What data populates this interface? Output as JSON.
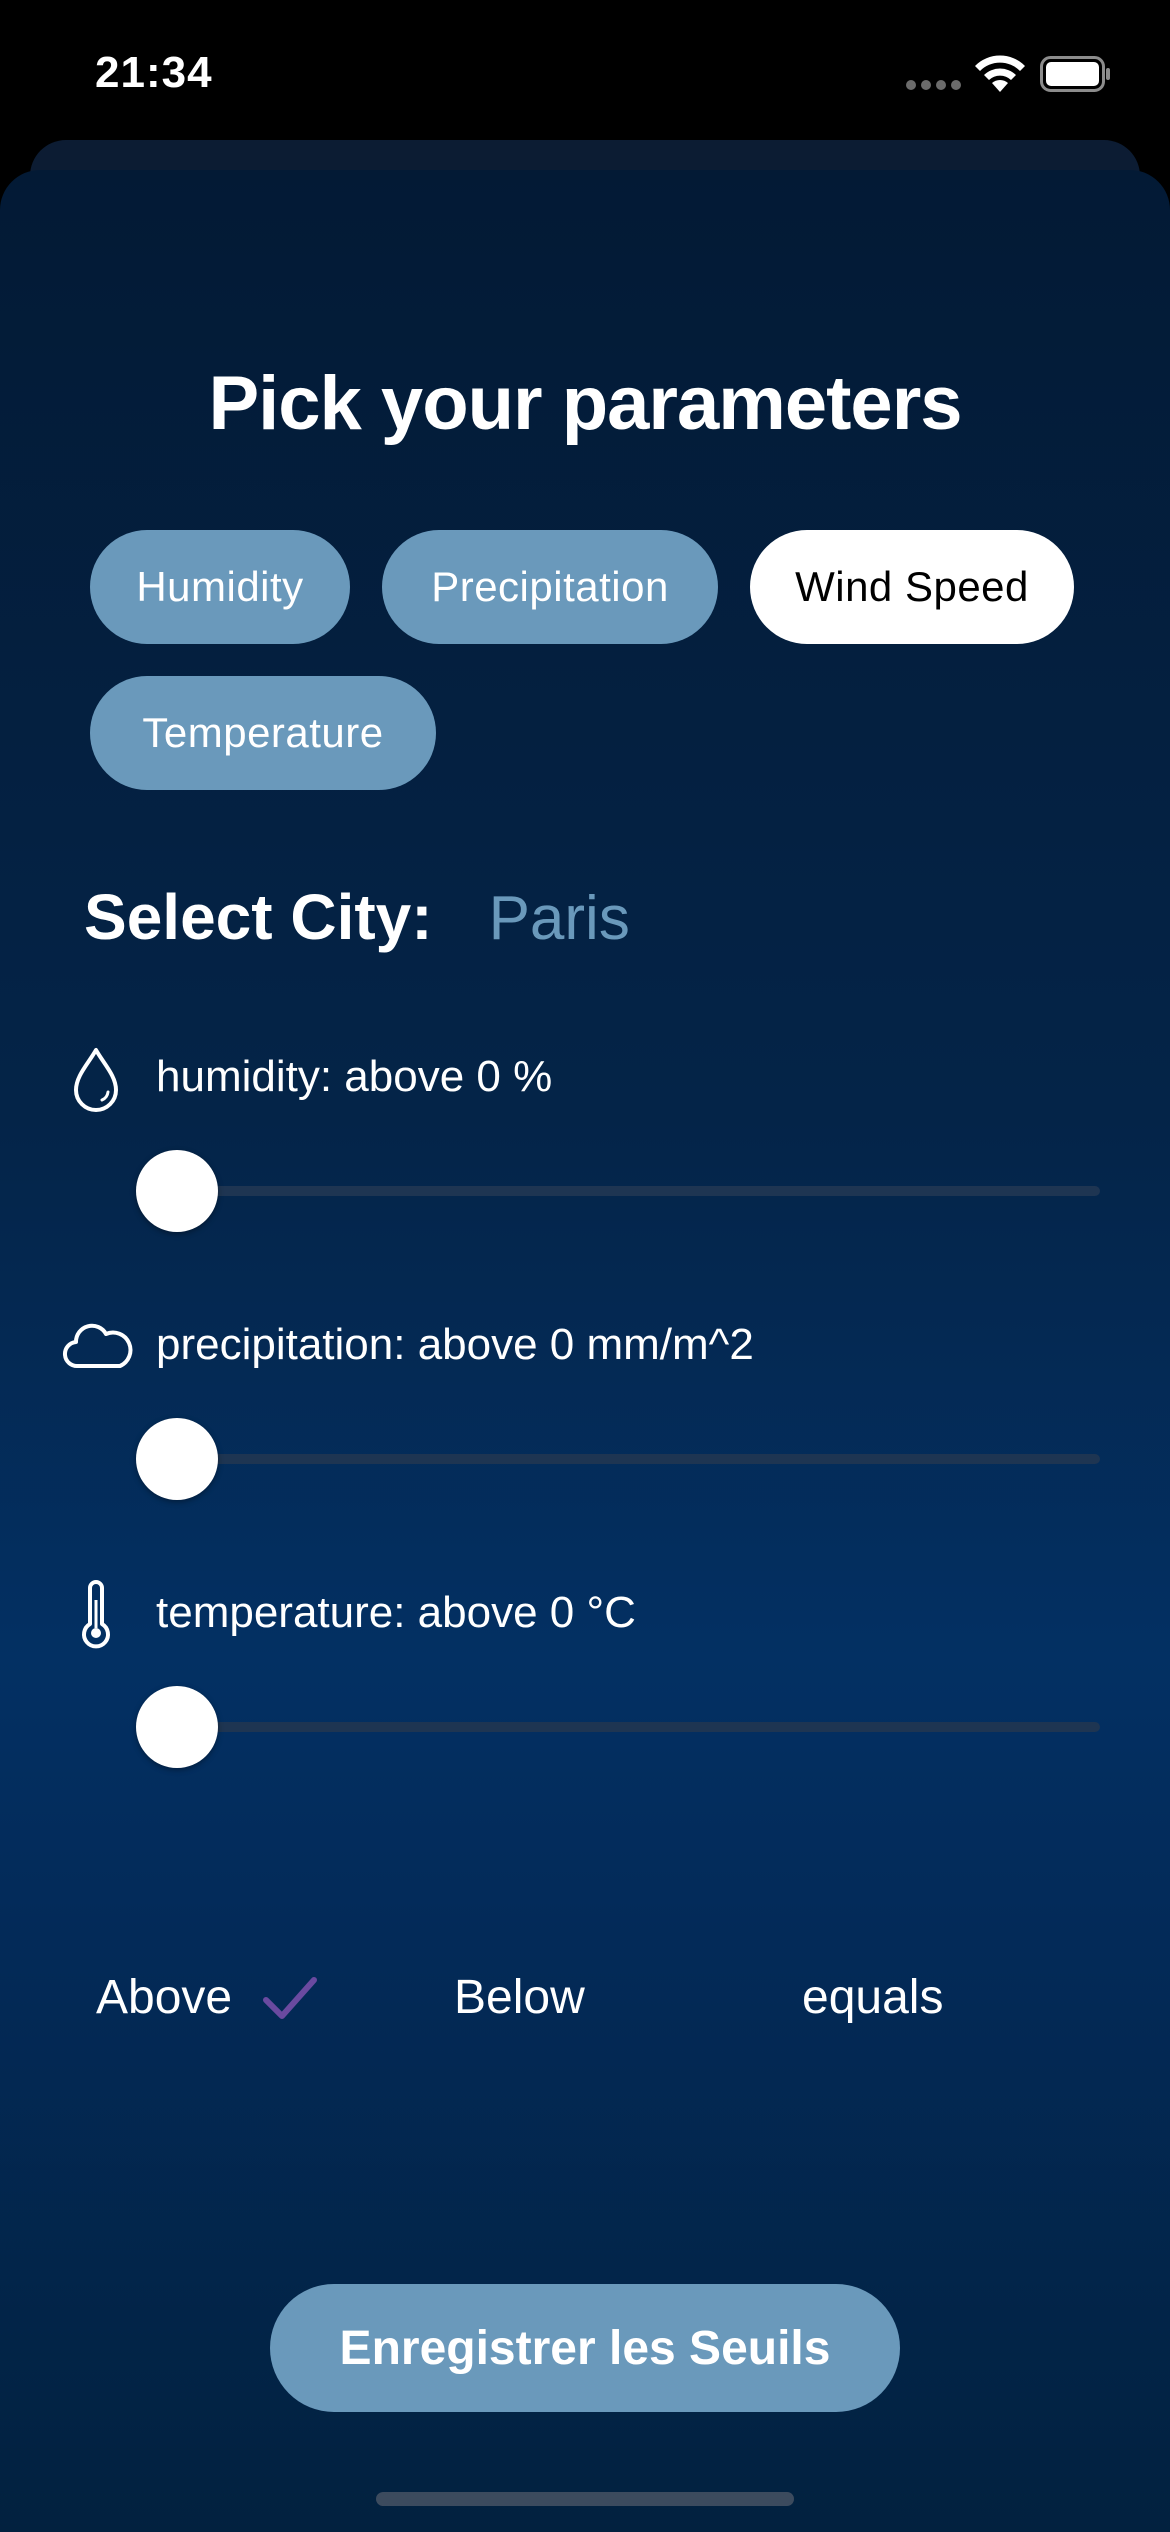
{
  "status_bar": {
    "time": "21:34"
  },
  "title": "Pick your parameters",
  "chips": [
    {
      "label": "Humidity",
      "selected": false
    },
    {
      "label": "Precipitation",
      "selected": false
    },
    {
      "label": "Wind Speed",
      "selected": true
    },
    {
      "label": "Temperature",
      "selected": false
    }
  ],
  "city": {
    "label": "Select City:",
    "value": "Paris"
  },
  "params": [
    {
      "icon": "droplet-icon",
      "label": "humidity: above 0 %",
      "value": 0
    },
    {
      "icon": "cloud-icon",
      "label": "precipitation: above 0 mm/m^2",
      "value": 0
    },
    {
      "icon": "thermometer-icon",
      "label": "temperature: above 0 °C",
      "value": 0
    }
  ],
  "modes": {
    "above": "Above",
    "below": "Below",
    "equals": "equals",
    "selected": "above"
  },
  "save_button": "Enregistrer les Seuils",
  "colors": {
    "accent": "#6a99bb",
    "check": "#6a4aa0",
    "background_top": "#031a35",
    "background_mid": "#033063"
  }
}
